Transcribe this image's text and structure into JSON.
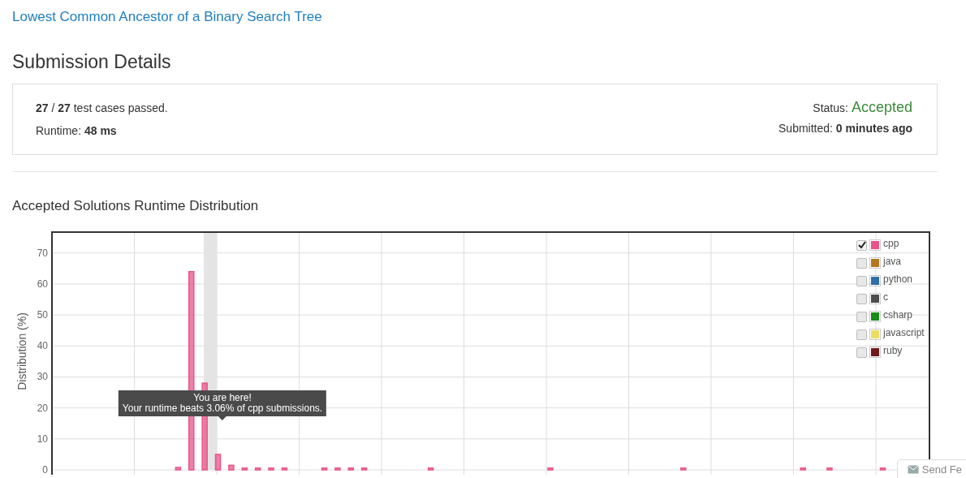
{
  "problem_link": "Lowest Common Ancestor of a Binary Search Tree",
  "heading": "Submission Details",
  "summary": {
    "cases": "**27** / **27** test cases passed.",
    "runtime": "Runtime: **48 ms**",
    "status_label": "Status:",
    "status": "Accepted",
    "submitted": "Submitted: **0 minutes ago**"
  },
  "distribution": {
    "title": "Accepted Solutions Runtime Distribution",
    "legend": [
      {
        "label": "cpp",
        "checked": true,
        "color": "#e8558a"
      },
      {
        "label": "java",
        "checked": false,
        "color": "#b5761e"
      },
      {
        "label": "python",
        "checked": false,
        "color": "#2f6fa8"
      },
      {
        "label": "c",
        "checked": false,
        "color": "#4d4d4d"
      },
      {
        "label": "csharp",
        "checked": false,
        "color": "#1a8a1a"
      },
      {
        "label": "javascript",
        "checked": false,
        "color": "#eede60"
      },
      {
        "label": "ruby",
        "checked": false,
        "color": "#701c1c"
      }
    ],
    "tooltip_title": "You are here!",
    "chart_data": {
      "type": "bar",
      "grid": true,
      "ylabel": "Distribution (%)",
      "ylim": [
        0,
        77
      ],
      "yticks": [
        0,
        10,
        20,
        30,
        40,
        50,
        60,
        70
      ],
      "values": [
        null,
        null,
        null,
        null,
        null,
        null,
        null,
        null,
        null,
        0.8,
        64,
        28,
        5,
        1.5,
        0.6,
        0.6,
        0.6,
        0.6,
        null,
        null,
        0.6,
        0.6,
        0.6,
        0.6,
        null,
        null,
        null,
        null,
        0.6,
        null,
        null,
        null,
        null,
        null,
        null,
        null,
        null,
        0.6,
        null,
        null,
        null,
        null,
        null,
        null,
        null,
        null,
        null,
        0.6,
        null,
        null,
        null,
        null,
        null,
        null,
        null,
        null,
        0.6,
        null,
        0.6,
        null,
        null,
        null,
        0.6,
        null,
        null,
        null
      ],
      "annotations": [
        "Your runtime beats 3.06% of cpp submissions."
      ]
    }
  },
  "feedback_button": "Send Fe"
}
